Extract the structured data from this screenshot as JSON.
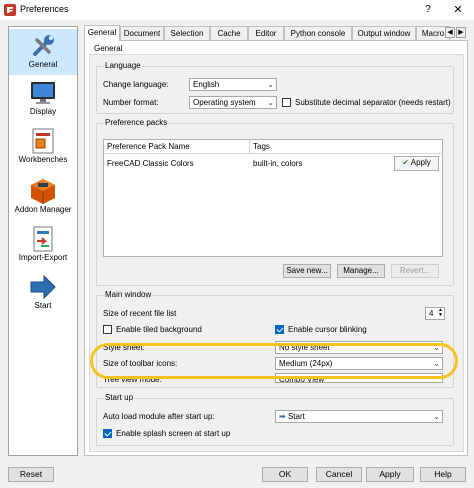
{
  "window": {
    "title": "Preferences",
    "help": "?",
    "close": "✕"
  },
  "sidebar": {
    "items": [
      {
        "label": "General",
        "icon": "wrench-icon"
      },
      {
        "label": "Display",
        "icon": "monitor-icon"
      },
      {
        "label": "Workbenches",
        "icon": "workbench-icon"
      },
      {
        "label": "Addon Manager",
        "icon": "addon-icon"
      },
      {
        "label": "Import-Export",
        "icon": "import-export-icon"
      },
      {
        "label": "Start",
        "icon": "arrow-right-icon"
      }
    ],
    "selected": "General"
  },
  "tabs": [
    "General",
    "Document",
    "Selection",
    "Cache",
    "Editor",
    "Python console",
    "Output window",
    "Macro"
  ],
  "active_tab": "General",
  "panel": {
    "title": "General"
  },
  "language": {
    "title": "Language",
    "change_language_label": "Change language:",
    "change_language_value": "English",
    "number_format_label": "Number format:",
    "number_format_value": "Operating system",
    "substitute_label": "Substitute decimal separator (needs restart)",
    "substitute_checked": false
  },
  "preference_packs": {
    "title": "Preference packs",
    "columns": [
      "Preference Pack Name",
      "Tags"
    ],
    "rows": [
      {
        "name": "FreeCAD Classic Colors",
        "tags": "built-in, colors",
        "apply": "Apply"
      }
    ],
    "save_new": "Save new...",
    "manage": "Manage...",
    "revert": "Revert..."
  },
  "main_window": {
    "title": "Main window",
    "recent_files_label": "Size of recent file list",
    "recent_files_value": "4",
    "tiled_bg_label": "Enable tiled background",
    "tiled_bg_checked": false,
    "cursor_blink_label": "Enable cursor blinking",
    "cursor_blink_checked": true,
    "style_sheet_label": "Style sheet:",
    "style_sheet_value": "No style sheet",
    "toolbar_icons_label": "Size of toolbar icons:",
    "toolbar_icons_value": "Medium (24px)",
    "tree_view_label": "Tree view mode:",
    "tree_view_value": "Combo View"
  },
  "start_up": {
    "title": "Start up",
    "auto_load_label": "Auto load module after start up:",
    "auto_load_value": "Start",
    "splash_label": "Enable splash screen at start up",
    "splash_checked": true
  },
  "buttons": {
    "reset": "Reset",
    "ok": "OK",
    "cancel": "Cancel",
    "apply": "Apply",
    "help": "Help"
  },
  "colors": {
    "highlight": "#f6c21c",
    "accent": "#0067c0",
    "selected_bg": "#cce8ff"
  }
}
